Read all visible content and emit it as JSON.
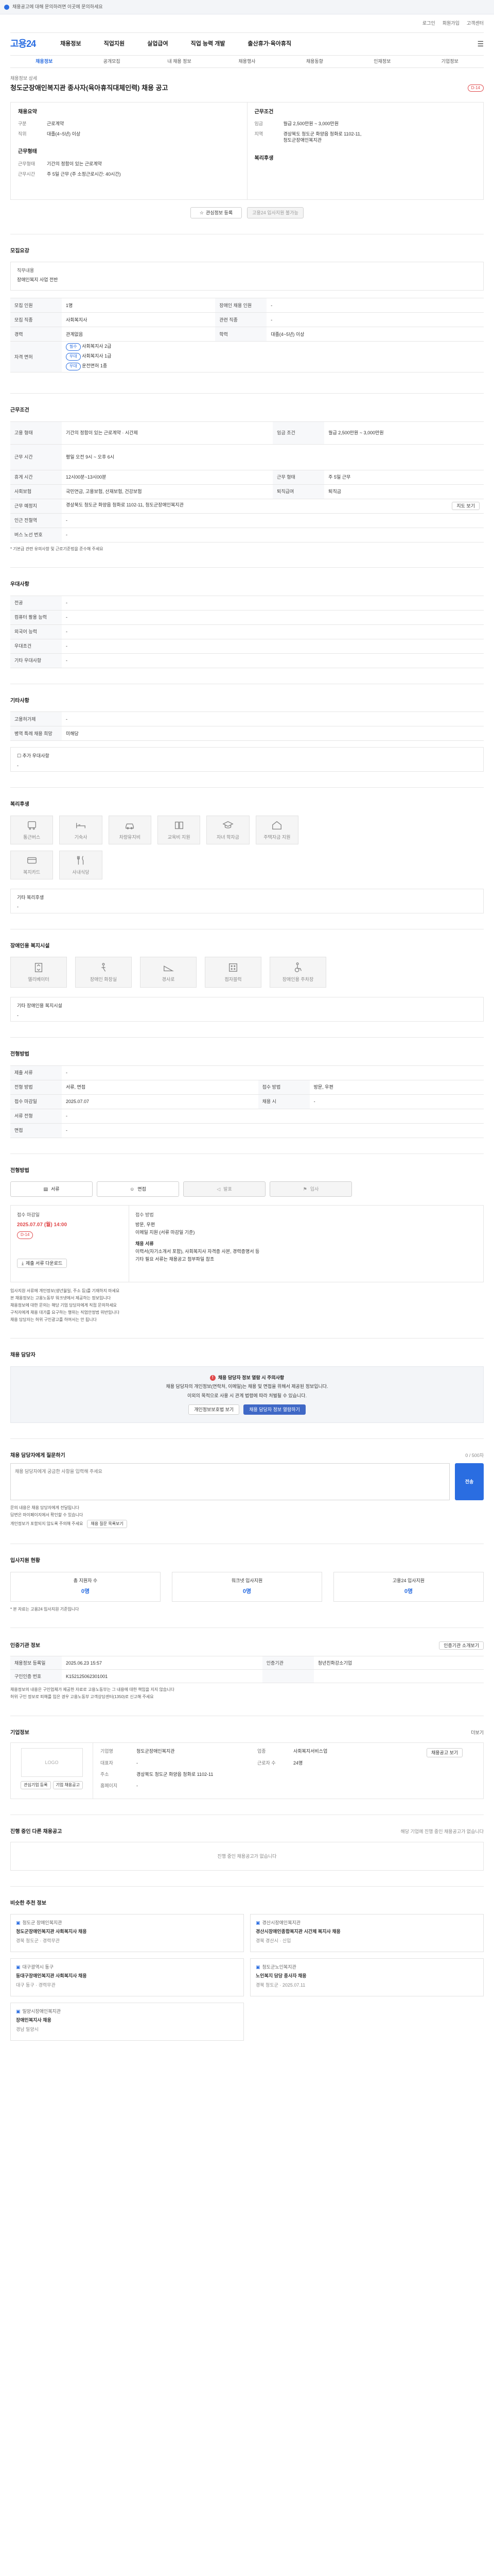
{
  "topbar": {
    "text": "채용공고에 대해 문의하려면 이곳에 문의하세요"
  },
  "header": {
    "links": [
      "로그인",
      "회원가입",
      "고객센터"
    ]
  },
  "logo": "고용24",
  "gnb": [
    "채용정보",
    "직업지원",
    "실업급여",
    "직업 능력 개발",
    "출산휴가·육아휴직"
  ],
  "subnav": [
    "채용정보",
    "공개모집",
    "내 채용 정보",
    "채용행사",
    "채용동향",
    "인재정보",
    "기업정보"
  ],
  "job": {
    "label": "채용정보 상세",
    "title": "청도군장애인복지관 종사자(육아휴직대체인력) 채용 공고",
    "dday": "D-14",
    "company_head": "채용요약",
    "company_lines": [
      {
        "k": "구분",
        "v": "근로계약"
      },
      {
        "k": "직위",
        "v": "대졸(4~5년) 이상"
      }
    ],
    "salary_head": "근무조건",
    "salary_lines": [
      {
        "k": "임금",
        "v": "월급 2,500만원 ~ 3,000만원"
      },
      {
        "k": "지역",
        "v": "경상북도 청도군 화양읍 청화로 1102-11, 청도군장애인복지관"
      }
    ],
    "recruit_head": "근무형태",
    "recruit_lines": [
      {
        "k": "근무형태",
        "v": "기간의 정함이 있는 근로계약"
      },
      {
        "k": "근무시간",
        "v": "주 5일 근무 (주 소정근로시간: 40시간)"
      }
    ],
    "welfare_head": "복리후생",
    "btn_scrap": "관심정보 등록",
    "btn_apply": "고용24 입사지원 불가능"
  },
  "req": {
    "title": "모집요강",
    "head": "직무내용",
    "desc": "장애인복지 사업 전반"
  },
  "req_table": [
    {
      "k": "모집 직종",
      "v": "사회복지사",
      "k2": "관련 직종",
      "v2": "-"
    },
    {
      "k": "모집 인원",
      "v": "1명",
      "k2": "장애인 채용 인원",
      "v2": "-"
    },
    {
      "k": "경력",
      "v": "관계없음",
      "k2": "학력",
      "v2": "대졸(4~5년) 이상"
    },
    {
      "k": "자격 면허",
      "v": "사회복지사 2급",
      "k2": "",
      "v2": ""
    }
  ],
  "req_extra": [
    "사회복지사 1급",
    "운전면허 1종"
  ],
  "work": {
    "title": "근무조건"
  },
  "work_table": [
    {
      "k": "고용 형태",
      "v": "기간의 정함이 있는 근로계약 · 시간제",
      "k2": "임금 조건",
      "v2": "월급 2,500만원 ~ 3,000만원"
    },
    {
      "k": "근무 시간",
      "v": "평일 오전 9시 ~ 오후 6시",
      "k2": "",
      "v2": ""
    },
    {
      "k": "휴게 시간",
      "v": "12시00분~13시00분",
      "k2": "근무 형태",
      "v2": "주 5일 근무"
    },
    {
      "k": "사회보험",
      "v": "국민연금, 고용보험, 산재보험, 건강보험",
      "k2": "퇴직급여",
      "v2": "퇴직금"
    },
    {
      "k": "근무 예정지",
      "v": "경상북도 청도군 화양읍 청화로 1102-11, 청도군장애인복지관",
      "k2": "",
      "v2": ""
    },
    {
      "k": "인근 전철역",
      "v": "-",
      "k2": "",
      "v2": ""
    },
    {
      "k": "버스 노선 번호",
      "v": "-",
      "k2": "",
      "v2": ""
    }
  ],
  "work_note": "* 기본급 관련 유의사항 및 근로기준법을 준수해 주세요",
  "btn_map": "지도 보기",
  "pref": {
    "title": "우대사항",
    "rows": [
      {
        "k": "전공",
        "v": "-"
      },
      {
        "k": "컴퓨터 활용 능력",
        "v": "-"
      },
      {
        "k": "외국어 능력",
        "v": "-"
      },
      {
        "k": "우대조건",
        "v": "-"
      },
      {
        "k": "기타 우대사항",
        "v": "-"
      }
    ]
  },
  "etc": {
    "title": "기타사항",
    "rows": [
      {
        "k": "고용허가제",
        "v": "-"
      },
      {
        "k": "병역 특례 채용 희망",
        "v": "미해당"
      }
    ],
    "more": "추가 우대사항"
  },
  "welfare": {
    "title": "복리후생",
    "items": [
      "통근버스",
      "기숙사",
      "차량유지비",
      "교육비 지원",
      "자녀 학자금",
      "주택자금 지원",
      "복지카드",
      "사내식당"
    ],
    "note": "기타 복리후생",
    "empty": "-"
  },
  "disab": {
    "title": "장애인용 복지시설",
    "items": [
      "엘리베이터",
      "장애인 화장실",
      "경사로",
      "점자블럭",
      "장애인용 주차장"
    ],
    "note": "기타 장애인용 복지시설",
    "empty": "-"
  },
  "applyreq": {
    "title": "전형방법",
    "rows": [
      {
        "k": "제출 서류",
        "v": "-",
        "k2": "",
        "v2": ""
      },
      {
        "k": "전형 방법",
        "v": "서류, 면접",
        "k2": "접수 방법",
        "v2": "방문, 우편"
      },
      {
        "k": "접수 마감일",
        "v": "2025.07.07",
        "k2": "채용 시",
        "v2": "-"
      },
      {
        "k": "서류 전형",
        "v": "-",
        "k2": "",
        "v2": ""
      },
      {
        "k": "면접",
        "v": "-",
        "k2": "",
        "v2": ""
      }
    ]
  },
  "steps": {
    "title": "전형방법",
    "items": [
      "서류",
      "면접",
      "발표",
      "입사"
    ]
  },
  "deadline": {
    "head": "접수 마감일",
    "date": "2025.07.07 (월) 14:00",
    "dday": "D-14",
    "btn": "제출 서류 다운로드"
  },
  "method": {
    "head": "접수 방법",
    "lines": [
      "방문, 우편",
      "이메일 지원 (서류 마감일 기준)",
      "채용 서류",
      "이력서(자기소개서 포함), 사회복지사 자격증 사본, 경력증명서 등",
      "기타 필요 서류는 채용공고 첨부파일 참조"
    ]
  },
  "method_notes": [
    "입사지원 서류에 개인정보(생년월일, 주소 등)를 기재하지 마세요",
    "본 채용정보는 고용노동부 워크넷에서 제공하는 정보입니다",
    "채용정보에 대한 문의는 해당 기업 담당자에게 직접 문의하세요",
    "구직자에게 채용 대가를 요구하는 행위는 직업안정법 위반입니다",
    "채용 담당자는 허위 구인광고를 하여서는 안 됩니다"
  ],
  "contact": {
    "title": "채용 담당자",
    "notice_title": "채용 담당자 정보 열람 시 주의사항",
    "notice_lines": [
      "채용 담당자의 개인정보(연락처, 이메일)는 채용 및 면접을 위해서 제공된 정보입니다.",
      "이외의 목적으로 사용 시 관계 법령에 따라 처벌될 수 있습니다."
    ],
    "btn1": "개인정보보호법 보기",
    "btn2": "채용 담당자 정보 열람하기"
  },
  "inquiry": {
    "title": "채용 담당자에게 질문하기",
    "count": "0 / 500자",
    "placeholder": "채용 담당자에게 궁금한 사항을 입력해 주세요",
    "btn": "전송",
    "notes": [
      "문의 내용은 채용 담당자에게 전달됩니다",
      "답변은 마이페이지에서 확인할 수 있습니다",
      "개인정보가 포함되지 않도록 주의해 주세요"
    ],
    "btn_more": "채용 질문 목록보기"
  },
  "status": {
    "title": "입사지원 현황",
    "items": [
      {
        "label": "총 지원자 수",
        "value": "0명"
      },
      {
        "label": "워크넷 입사지원",
        "value": "0명"
      },
      {
        "label": "고용24 입사지원",
        "value": "0명"
      }
    ],
    "note": "* 본 자료는 고용24 입사지원 기준입니다"
  },
  "info": {
    "title": "인증기관 정보",
    "btn": "인증기관 소개보기",
    "rows": [
      {
        "k": "채용정보 등록일",
        "v": "2025.06.23 15:57",
        "k2": "인증기관",
        "v2": "청년친화강소기업"
      },
      {
        "k": "구인인증 번호",
        "v": "K152125062301001",
        "k2": "",
        "v2": ""
      }
    ],
    "notes": [
      "채용정보의 내용은 구인업체가 제공한 자료로 고용노동부는 그 내용에 대한 책임을 지지 않습니다",
      "허위 구인 정보로 피해를 입은 경우 고용노동부 고객상담센터(1350)로 신고해 주세요"
    ]
  },
  "company": {
    "title": "기업정보",
    "more": "더보기",
    "logo": "LOGO",
    "btn1": "관심기업 등록",
    "btn2": "기업 채용공고",
    "rows": [
      {
        "k": "기업명",
        "v": "청도군장애인복지관",
        "k2": "업종",
        "v2": "사회복지서비스업"
      },
      {
        "k": "대표자",
        "v": "-",
        "k2": "근로자 수",
        "v2": "24명"
      },
      {
        "k": "주소",
        "v": "경상북도 청도군 화양읍 청화로 1102-11",
        "k2": "",
        "v2": ""
      },
      {
        "k": "홈페이지",
        "v": "-",
        "k2": "",
        "v2": ""
      }
    ],
    "btn3": "채용공고 보기"
  },
  "similar": {
    "title": "진행 중인 다른 채용공고",
    "sub": "해당 기업에 진행 중인 채용공고가 없습니다",
    "empty": "진행 중인 채용공고가 없습니다"
  },
  "recommend": {
    "title": "비슷한 추천 정보",
    "cards": [
      {
        "org": "청도군 장애인복지관",
        "title": "청도군장애인복지관 사회복지사 채용",
        "meta": "경북 청도군 · 경력무관"
      },
      {
        "org": "경산시장애인복지관",
        "title": "경산시장애인종합복지관 시간제 복지사 채용",
        "meta": "경북 경산시 · 신입"
      },
      {
        "org": "대구광역시 동구",
        "title": "동대구장애인복지관 사회복지사 채용",
        "meta": "대구 동구 · 경력무관"
      },
      {
        "org": "청도군노인복지관",
        "title": "노인복지 담당 종사자 채용",
        "meta": "경북 청도군 · 2025.07.11"
      },
      {
        "org": "밀양시장애인복지관",
        "title": "장애인복지사 채용",
        "meta": "경남 밀양시"
      }
    ]
  }
}
